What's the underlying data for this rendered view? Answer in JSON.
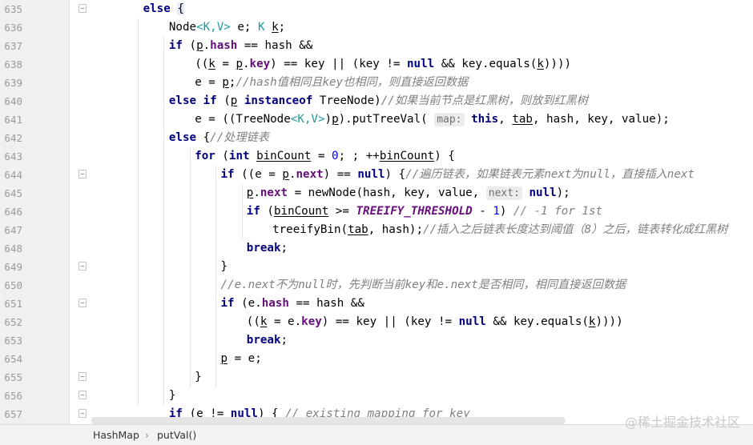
{
  "editor": {
    "lines": [
      {
        "no": "635",
        "indent": 4,
        "fold": true,
        "tokens": [
          {
            "t": "else",
            "c": "kw"
          },
          {
            "t": " "
          },
          {
            "t": "{",
            "c": "brace-hl"
          }
        ]
      },
      {
        "no": "636",
        "indent": 5,
        "tokens": [
          {
            "t": "Node"
          },
          {
            "t": "<",
            "c": "tp"
          },
          {
            "t": "K",
            "c": "tp"
          },
          {
            "t": ",",
            "c": "tp"
          },
          {
            "t": "V",
            "c": "tp"
          },
          {
            "t": ">",
            "c": "tp"
          },
          {
            "t": " e; "
          },
          {
            "t": "K",
            "c": "tp"
          },
          {
            "t": " "
          },
          {
            "t": "k",
            "c": "ul"
          },
          {
            "t": ";"
          }
        ]
      },
      {
        "no": "637",
        "indent": 5,
        "tokens": [
          {
            "t": "if",
            "c": "kw"
          },
          {
            "t": " ("
          },
          {
            "t": "p",
            "c": "ul"
          },
          {
            "t": "."
          },
          {
            "t": "hash",
            "c": "fld"
          },
          {
            "t": " == hash &&"
          }
        ]
      },
      {
        "no": "638",
        "indent": 6,
        "tokens": [
          {
            "t": "(("
          },
          {
            "t": "k",
            "c": "ul"
          },
          {
            "t": " = "
          },
          {
            "t": "p",
            "c": "ul"
          },
          {
            "t": "."
          },
          {
            "t": "key",
            "c": "fld"
          },
          {
            "t": ") == key || (key != "
          },
          {
            "t": "null",
            "c": "kw"
          },
          {
            "t": " && key.equals("
          },
          {
            "t": "k",
            "c": "ul"
          },
          {
            "t": "))))"
          }
        ]
      },
      {
        "no": "639",
        "indent": 6,
        "tokens": [
          {
            "t": "e = "
          },
          {
            "t": "p",
            "c": "ul"
          },
          {
            "t": ";"
          },
          {
            "t": "//hash值相同且key也相同，则直接返回数据",
            "c": "cmt"
          }
        ]
      },
      {
        "no": "640",
        "indent": 5,
        "tokens": [
          {
            "t": "else",
            "c": "kw"
          },
          {
            "t": " "
          },
          {
            "t": "if",
            "c": "kw"
          },
          {
            "t": " ("
          },
          {
            "t": "p",
            "c": "ul"
          },
          {
            "t": " "
          },
          {
            "t": "instanceof",
            "c": "kw"
          },
          {
            "t": " TreeNode)"
          },
          {
            "t": "//如果当前节点是红黑树，则放到红黑树",
            "c": "cmt"
          }
        ]
      },
      {
        "no": "641",
        "indent": 6,
        "tokens": [
          {
            "t": "e = ((TreeNode"
          },
          {
            "t": "<",
            "c": "tp"
          },
          {
            "t": "K",
            "c": "tp"
          },
          {
            "t": ",",
            "c": "tp"
          },
          {
            "t": "V",
            "c": "tp"
          },
          {
            "t": ">",
            "c": "tp"
          },
          {
            "t": ")"
          },
          {
            "t": "p",
            "c": "ul"
          },
          {
            "t": ").putTreeVal( "
          },
          {
            "t": "map:",
            "c": "hint"
          },
          {
            "t": " "
          },
          {
            "t": "this",
            "c": "kw"
          },
          {
            "t": ", "
          },
          {
            "t": "tab",
            "c": "ul"
          },
          {
            "t": ", hash, key, value);"
          }
        ]
      },
      {
        "no": "642",
        "indent": 5,
        "tokens": [
          {
            "t": "else",
            "c": "kw"
          },
          {
            "t": " {"
          },
          {
            "t": "//处理链表",
            "c": "cmt"
          }
        ]
      },
      {
        "no": "643",
        "indent": 6,
        "tokens": [
          {
            "t": "for",
            "c": "kw"
          },
          {
            "t": " ("
          },
          {
            "t": "int",
            "c": "kw"
          },
          {
            "t": " "
          },
          {
            "t": "binCount",
            "c": "ul"
          },
          {
            "t": " = "
          },
          {
            "t": "0",
            "c": "num"
          },
          {
            "t": "; ; ++"
          },
          {
            "t": "binCount",
            "c": "ul"
          },
          {
            "t": ") {"
          }
        ]
      },
      {
        "no": "644",
        "indent": 7,
        "fold": true,
        "tokens": [
          {
            "t": "if",
            "c": "kw"
          },
          {
            "t": " ((e = "
          },
          {
            "t": "p",
            "c": "ul"
          },
          {
            "t": "."
          },
          {
            "t": "next",
            "c": "fld"
          },
          {
            "t": ") == "
          },
          {
            "t": "null",
            "c": "kw"
          },
          {
            "t": ") {"
          },
          {
            "t": "//遍历链表，如果链表元素next为null，直接插入next",
            "c": "cmt"
          }
        ]
      },
      {
        "no": "645",
        "indent": 8,
        "tokens": [
          {
            "t": "p",
            "c": "ul"
          },
          {
            "t": "."
          },
          {
            "t": "next",
            "c": "fld"
          },
          {
            "t": " = newNode(hash, key, value, "
          },
          {
            "t": "next:",
            "c": "hint"
          },
          {
            "t": " "
          },
          {
            "t": "null",
            "c": "kw"
          },
          {
            "t": ");"
          }
        ]
      },
      {
        "no": "646",
        "indent": 8,
        "tokens": [
          {
            "t": "if",
            "c": "kw"
          },
          {
            "t": " ("
          },
          {
            "t": "binCount",
            "c": "ul"
          },
          {
            "t": " >= "
          },
          {
            "t": "TREEIFY_THRESHOLD",
            "c": "cst"
          },
          {
            "t": " - "
          },
          {
            "t": "1",
            "c": "num"
          },
          {
            "t": ") "
          },
          {
            "t": "// -1 for 1st",
            "c": "cmt"
          }
        ]
      },
      {
        "no": "647",
        "indent": 9,
        "tokens": [
          {
            "t": "treeifyBin("
          },
          {
            "t": "tab",
            "c": "ul"
          },
          {
            "t": ", hash);"
          },
          {
            "t": "//插入之后链表长度达到阈值（8）之后，链表转化成红黑树",
            "c": "cmt"
          }
        ]
      },
      {
        "no": "648",
        "indent": 8,
        "tokens": [
          {
            "t": "break",
            "c": "kw"
          },
          {
            "t": ";"
          }
        ]
      },
      {
        "no": "649",
        "indent": 7,
        "fold": true,
        "tokens": [
          {
            "t": "}"
          }
        ]
      },
      {
        "no": "650",
        "indent": 7,
        "tokens": [
          {
            "t": "//e.next不为null时，先判断当前key和e.next是否相同，相同直接返回数据",
            "c": "cmt"
          }
        ]
      },
      {
        "no": "651",
        "indent": 7,
        "fold": true,
        "tokens": [
          {
            "t": "if",
            "c": "kw"
          },
          {
            "t": " (e."
          },
          {
            "t": "hash",
            "c": "fld"
          },
          {
            "t": " == hash &&"
          }
        ]
      },
      {
        "no": "652",
        "indent": 8,
        "tokens": [
          {
            "t": "(("
          },
          {
            "t": "k",
            "c": "ul"
          },
          {
            "t": " = e."
          },
          {
            "t": "key",
            "c": "fld"
          },
          {
            "t": ") == key || (key != "
          },
          {
            "t": "null",
            "c": "kw"
          },
          {
            "t": " && key.equals("
          },
          {
            "t": "k",
            "c": "ul"
          },
          {
            "t": "))))"
          }
        ]
      },
      {
        "no": "653",
        "indent": 8,
        "tokens": [
          {
            "t": "break",
            "c": "kw"
          },
          {
            "t": ";"
          }
        ]
      },
      {
        "no": "654",
        "indent": 7,
        "tokens": [
          {
            "t": "p",
            "c": "ul"
          },
          {
            "t": " = e;"
          }
        ]
      },
      {
        "no": "655",
        "indent": 6,
        "fold": true,
        "tokens": [
          {
            "t": "}"
          }
        ]
      },
      {
        "no": "656",
        "indent": 5,
        "fold": true,
        "tokens": [
          {
            "t": "}"
          }
        ]
      },
      {
        "no": "657",
        "indent": 5,
        "fold": true,
        "tokens": [
          {
            "t": "if",
            "c": "kw"
          },
          {
            "t": " (e != "
          },
          {
            "t": "null",
            "c": "kw"
          },
          {
            "t": ") { "
          },
          {
            "t": "// existing mapping for key",
            "c": "cmt"
          }
        ]
      }
    ]
  },
  "breadcrumb": {
    "items": [
      "HashMap",
      "putVal()"
    ],
    "separator": "›"
  },
  "watermark": "@稀土掘金技术社区",
  "colors": {
    "keyword": "#000080",
    "field": "#660e7a",
    "comment": "#808080",
    "number": "#0000ff",
    "type_param": "#20999d"
  }
}
